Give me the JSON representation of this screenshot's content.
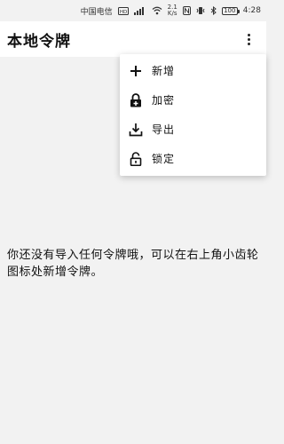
{
  "status_bar": {
    "carrier": "中国电信",
    "net_speed_value": "2.1",
    "net_speed_unit": "K/s",
    "battery_level": "100",
    "time": "4:28"
  },
  "app_bar": {
    "title": "本地令牌",
    "more_icon": "more-vert-icon"
  },
  "menu": {
    "items": [
      {
        "label": "新增",
        "icon": "plus-icon"
      },
      {
        "label": "加密",
        "icon": "lock-add-icon"
      },
      {
        "label": "导出",
        "icon": "download-icon"
      },
      {
        "label": "锁定",
        "icon": "lock-open-icon"
      }
    ]
  },
  "main": {
    "empty_message": "你还没有导入任何令牌哦，可以在右上角小齿轮图标处新增令牌。"
  }
}
